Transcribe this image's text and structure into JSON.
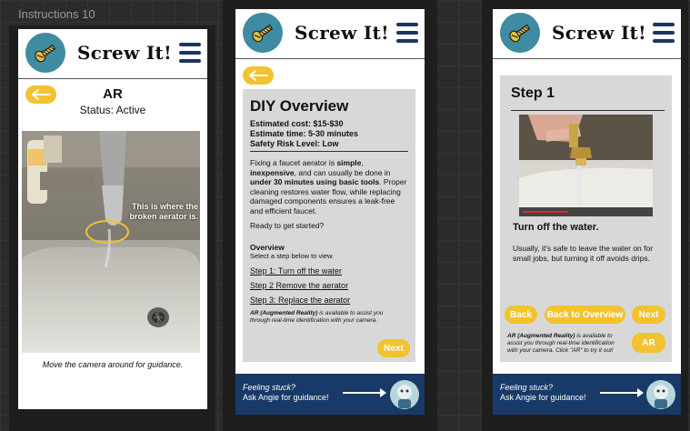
{
  "canvas": {
    "frame_label": "Instructions 10"
  },
  "brand": {
    "name": "Screw It!"
  },
  "screen1": {
    "title": "AR",
    "status": "Status: Active",
    "callout": "This is where the broken aerator is.",
    "hint": "Move the camera around for guidance."
  },
  "screen2": {
    "title": "DIY Overview",
    "cost": "Estimated cost: $15-$30",
    "time": "Estimate time: 5-30 minutes",
    "risk": "Safety Risk Level: Low",
    "para_1": "Fixing a faucet aerator is ",
    "para_b1": "simple",
    "para_2": ", ",
    "para_b2": "inexpensive",
    "para_3": ", and can usually be done in ",
    "para_b3": "under 30 minutes using basic tools",
    "para_4": ". Proper cleaning restores water flow, while replacing damaged components ensures a leak-free and efficient faucet.",
    "ready": "Ready to get started?",
    "overview_heading": "Overview",
    "overview_sub": "Select a step below to view.",
    "steps": [
      "Step 1: Turn off the water",
      "Step 2 Remove the aerator",
      "Step 3: Replace the aerator"
    ],
    "ar_bold": "AR (Augmented Reality)",
    "ar_rest": " is available to assist you through real-time identification with your camera.",
    "next_label": "Next"
  },
  "screen3": {
    "title": "Step 1",
    "heading": "Turn off the water.",
    "body": "Usually, it's safe to leave the water on for small jobs, but turning it off avoids drips.",
    "back_label": "Back",
    "overview_label": "Back to Overview",
    "next_label": "Next",
    "ar_bold": "AR (Augmented Reality)",
    "ar_rest": " is available to assist you through real-time identification with your camera. Click \"AR\" to try it out!",
    "ar_button": "AR"
  },
  "footer": {
    "line1": "Feeling stuck?",
    "line2": "Ask Angie for guidance!"
  },
  "colors": {
    "accent_yellow": "#f2c230",
    "navy": "#183a68",
    "logo_teal": "#3f8ba2",
    "card_gray": "#d8d8d8"
  },
  "icons": [
    "screw-logo-icon",
    "hamburger-menu-icon",
    "back-arrow-icon",
    "arrow-right-icon",
    "angie-avatar-icon"
  ]
}
